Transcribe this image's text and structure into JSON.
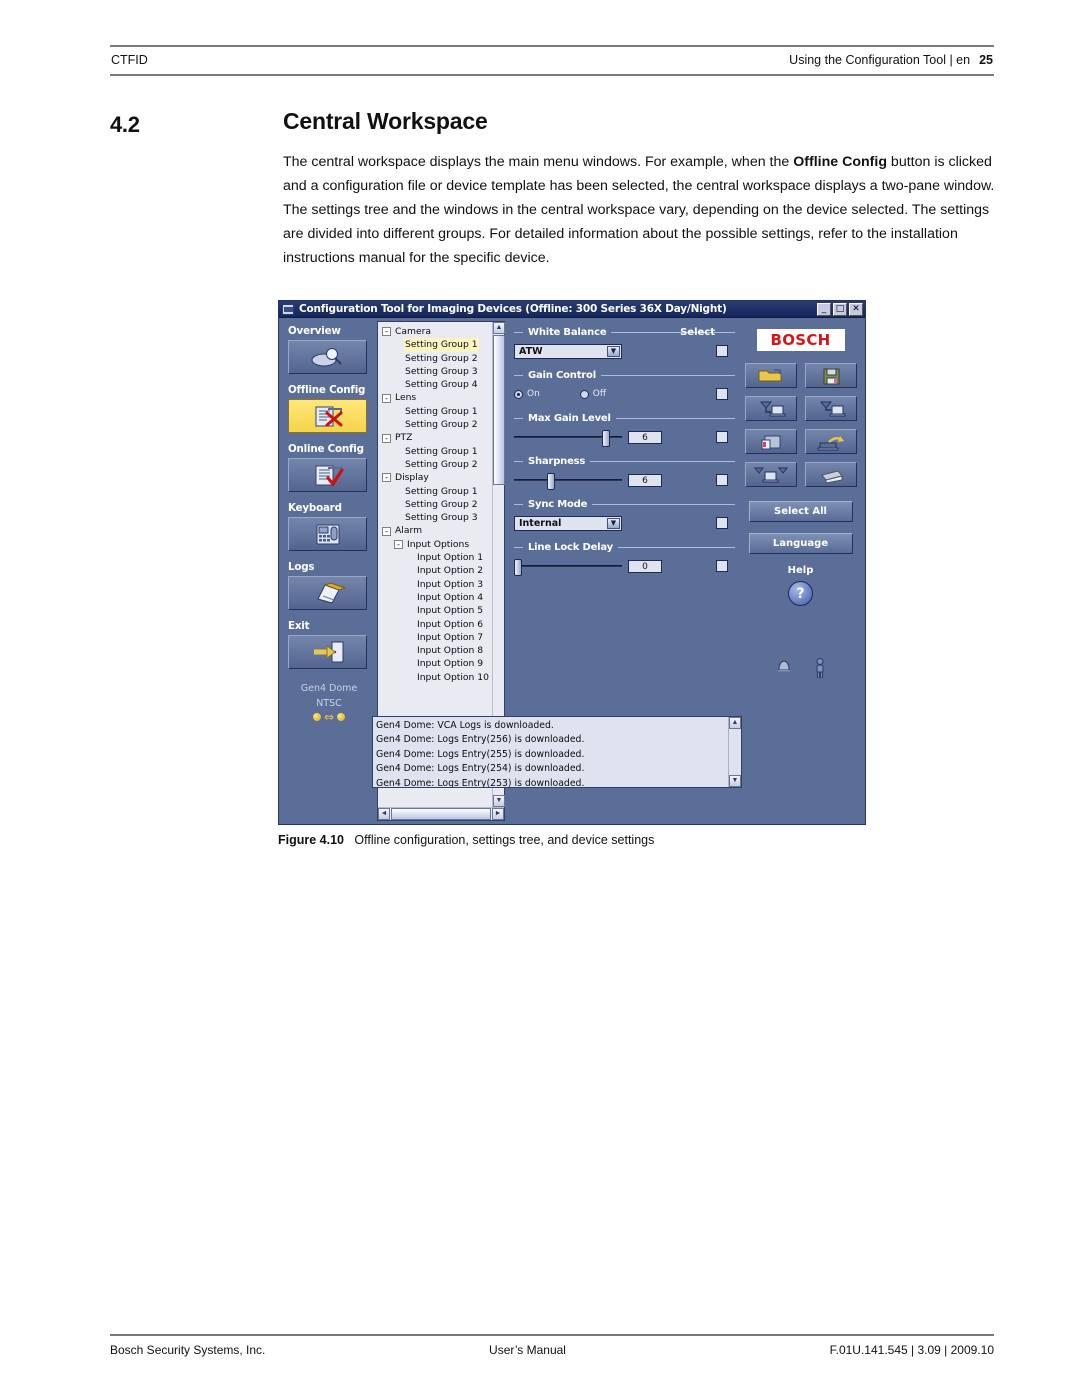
{
  "header": {
    "left": "CTFID",
    "right": "Using the Configuration Tool | en",
    "page": "25"
  },
  "section": {
    "number": "4.2",
    "title": "Central Workspace"
  },
  "paragraph": {
    "part1": "The central workspace displays the main menu windows. For example, when the ",
    "bold1": "Offline Config",
    "part2": " button is clicked and a configuration file or device template has been selected, the central workspace displays a two-pane window. The settings tree and the windows in the central workspace vary, depending on the device selected. The settings are divided into different groups. For detailed information about the possible settings, refer to the installation instructions manual for the specific device."
  },
  "app": {
    "titlebar": {
      "title": "Configuration Tool for Imaging Devices (Offline: 300 Series 36X Day/Night)",
      "minimize": "_",
      "maximize": "□",
      "close": "✕"
    },
    "sidebar": {
      "items": [
        {
          "label": "Overview",
          "icon": "magnifier-disc-icon",
          "active": false
        },
        {
          "label": "Offline Config",
          "icon": "document-x-icon",
          "active": true
        },
        {
          "label": "Online Config",
          "icon": "document-check-icon",
          "active": false
        },
        {
          "label": "Keyboard",
          "icon": "keyboard-icon",
          "active": false
        },
        {
          "label": "Logs",
          "icon": "logbook-pencil-icon",
          "active": false
        },
        {
          "label": "Exit",
          "icon": "exit-door-arrow-icon",
          "active": false
        }
      ],
      "status": {
        "device": "Gen4 Dome",
        "video_standard": "NTSC",
        "link_icon": "bidirectional-link-icon"
      }
    },
    "tree": {
      "nodes": [
        {
          "label": "Camera",
          "level": 0,
          "expander": "-",
          "selected": false
        },
        {
          "label": "Setting Group 1",
          "level": 1,
          "expander": "",
          "selected": true
        },
        {
          "label": "Setting Group 2",
          "level": 1,
          "expander": "",
          "selected": false
        },
        {
          "label": "Setting Group 3",
          "level": 1,
          "expander": "",
          "selected": false
        },
        {
          "label": "Setting Group 4",
          "level": 1,
          "expander": "",
          "selected": false
        },
        {
          "label": "Lens",
          "level": 0,
          "expander": "-",
          "selected": false
        },
        {
          "label": "Setting Group 1",
          "level": 1,
          "expander": "",
          "selected": false
        },
        {
          "label": "Setting Group 2",
          "level": 1,
          "expander": "",
          "selected": false
        },
        {
          "label": "PTZ",
          "level": 0,
          "expander": "-",
          "selected": false
        },
        {
          "label": "Setting Group 1",
          "level": 1,
          "expander": "",
          "selected": false
        },
        {
          "label": "Setting Group 2",
          "level": 1,
          "expander": "",
          "selected": false
        },
        {
          "label": "Display",
          "level": 0,
          "expander": "-",
          "selected": false
        },
        {
          "label": "Setting Group 1",
          "level": 1,
          "expander": "",
          "selected": false
        },
        {
          "label": "Setting Group 2",
          "level": 1,
          "expander": "",
          "selected": false
        },
        {
          "label": "Setting Group 3",
          "level": 1,
          "expander": "",
          "selected": false
        },
        {
          "label": "Alarm",
          "level": 0,
          "expander": "-",
          "selected": false
        },
        {
          "label": "Input Options",
          "level": 2,
          "expander": "-",
          "selected": false
        },
        {
          "label": "Input Option 1",
          "level": 3,
          "expander": "",
          "selected": false
        },
        {
          "label": "Input Option 2",
          "level": 3,
          "expander": "",
          "selected": false
        },
        {
          "label": "Input Option 3",
          "level": 3,
          "expander": "",
          "selected": false
        },
        {
          "label": "Input Option 4",
          "level": 3,
          "expander": "",
          "selected": false
        },
        {
          "label": "Input Option 5",
          "level": 3,
          "expander": "",
          "selected": false
        },
        {
          "label": "Input Option 6",
          "level": 3,
          "expander": "",
          "selected": false
        },
        {
          "label": "Input Option 7",
          "level": 3,
          "expander": "",
          "selected": false
        },
        {
          "label": "Input Option 8",
          "level": 3,
          "expander": "",
          "selected": false
        },
        {
          "label": "Input Option 9",
          "level": 3,
          "expander": "",
          "selected": false
        },
        {
          "label": "Input Option 10",
          "level": 3,
          "expander": "",
          "selected": false
        }
      ],
      "scroll_up": "▲",
      "scroll_down": "▼",
      "scroll_left": "◄",
      "scroll_right": "►"
    },
    "settings": {
      "select_column_label": "Select",
      "groups": [
        {
          "title": "White Balance",
          "control": "combo",
          "value": "ATW",
          "checked": false
        },
        {
          "title": "Gain Control",
          "control": "radio",
          "options": [
            "On",
            "Off"
          ],
          "value": "On",
          "checked": false
        },
        {
          "title": "Max Gain Level",
          "control": "slider",
          "value": "6",
          "position": 88,
          "checked": false
        },
        {
          "title": "Sharpness",
          "control": "slider",
          "value": "6",
          "position": 33,
          "checked": false
        },
        {
          "title": "Sync Mode",
          "control": "combo",
          "value": "Internal",
          "checked": false
        },
        {
          "title": "Line Lock Delay",
          "control": "slider",
          "value": "0",
          "position": 0,
          "checked": false
        }
      ]
    },
    "toolpanel": {
      "logo": "BOSCH",
      "buttons": [
        {
          "icon": "open-folder-icon"
        },
        {
          "icon": "floppy-save-icon"
        },
        {
          "icon": "download-to-pc-icon"
        },
        {
          "icon": "upload-from-pc-icon"
        },
        {
          "icon": "copy-file-icon"
        },
        {
          "icon": "device-update-icon"
        },
        {
          "icon": "multi-device-icon"
        },
        {
          "icon": "print-icon"
        }
      ],
      "select_all": "Select All",
      "language": "Language",
      "help_label": "Help",
      "help_icon": "?",
      "status_icons": [
        {
          "icon": "bell-alarm-icon"
        },
        {
          "icon": "person-icon"
        }
      ]
    },
    "log": {
      "lines": [
        "Gen4 Dome: VCA Logs is downloaded.",
        "Gen4 Dome: Logs Entry(256) is downloaded.",
        "Gen4 Dome: Logs Entry(255) is downloaded.",
        "Gen4 Dome: Logs Entry(254) is downloaded.",
        "Gen4 Dome: Logs Entry(253) is downloaded."
      ],
      "scroll_up": "▲",
      "scroll_down": "▼"
    }
  },
  "figure": {
    "label": "Figure 4.10",
    "caption": "Offline configuration, settings tree, and device settings"
  },
  "footer": {
    "left": "Bosch Security Systems, Inc.",
    "center": "User’s Manual",
    "right": "F.01U.141.545 | 3.09 | 2009.10"
  },
  "colors": {
    "brand_red": "#d7141a",
    "titlebar": "#16265a",
    "panel": "#5b6e97",
    "highlight": "#f5d44a"
  }
}
